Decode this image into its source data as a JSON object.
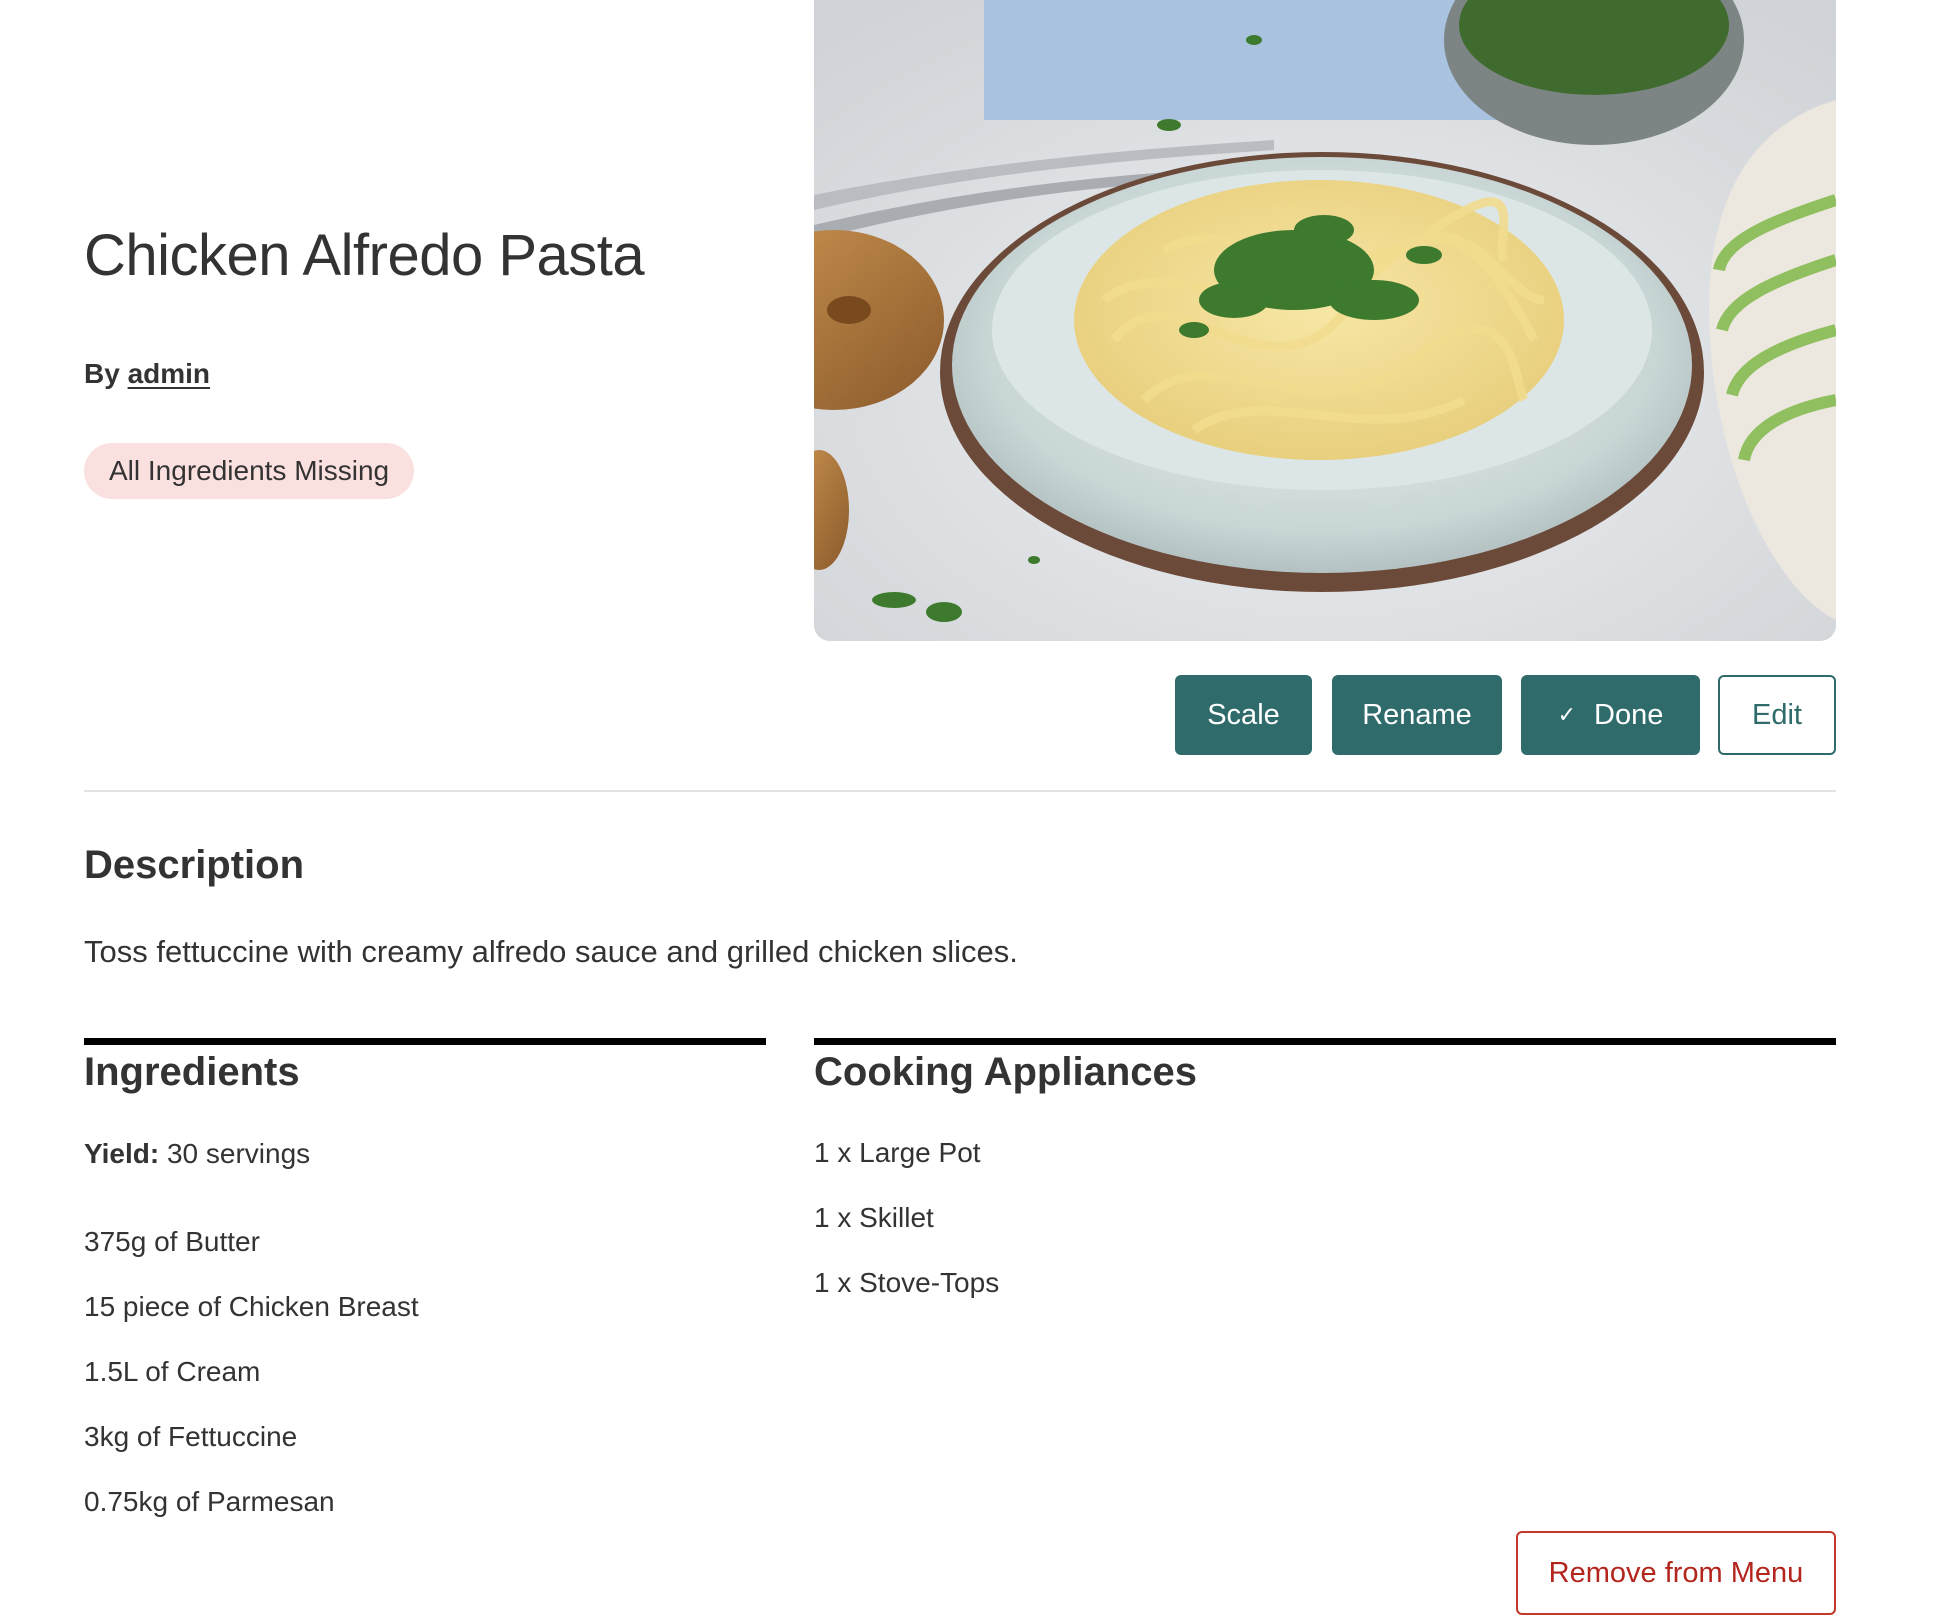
{
  "recipe": {
    "title": "Chicken Alfredo Pasta",
    "by_prefix": "By",
    "author": "admin",
    "status_badge": "All Ingredients Missing",
    "status_badge_color": "#fae0df"
  },
  "hero_image": {
    "alt": "photo-chicken-alfredo-pasta"
  },
  "actions": {
    "scale_label": "Scale",
    "rename_label": "Rename",
    "done_icon": "✓",
    "done_label": "Done",
    "edit_label": "Edit",
    "accent_color": "#2f6b6b"
  },
  "description": {
    "heading": "Description",
    "text": "Toss fettuccine with creamy alfredo sauce and grilled chicken slices."
  },
  "ingredients": {
    "heading": "Ingredients",
    "yield_label": "Yield:",
    "yield_value": "30 servings",
    "items": [
      "375g of Butter",
      "15 piece of Chicken Breast",
      "1.5L of Cream",
      "3kg of Fettuccine",
      "0.75kg of Parmesan"
    ]
  },
  "appliances": {
    "heading": "Cooking Appliances",
    "items": [
      "1 x Large Pot",
      "1 x Skillet",
      "1 x Stove-Tops"
    ]
  },
  "footer": {
    "remove_label": "Remove from Menu",
    "remove_color": "#b3261e"
  }
}
